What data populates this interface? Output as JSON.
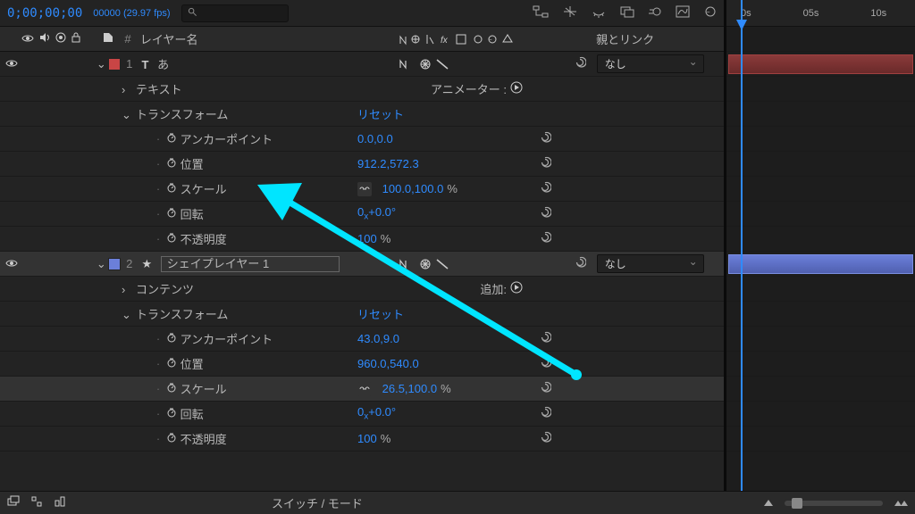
{
  "topbar": {
    "timecode": "0;00;00;00",
    "fps": "00000 (29.97 fps)"
  },
  "ruler": {
    "t0": "0s",
    "t1": "05s",
    "t2": "10s"
  },
  "header": {
    "name": "レイヤー名",
    "parent": "親とリンク",
    "hash": "#"
  },
  "layer1": {
    "num": "1",
    "type_glyph": "T",
    "name": "あ",
    "parent": "なし",
    "text_group": "テキスト",
    "animator": "アニメーター :",
    "transform": "トランスフォーム",
    "reset": "リセット",
    "anchor_label": "アンカーポイント",
    "anchor_val": "0.0,0.0",
    "pos_label": "位置",
    "pos_val": "912.2,572.3",
    "scale_label": "スケール",
    "scale_val": "100.0,100.0",
    "scale_unit": "%",
    "rot_label": "回転",
    "rot_x": "0",
    "rot_deg": "+0.0°",
    "op_label": "不透明度",
    "op_val": "100",
    "op_unit": "%"
  },
  "layer2": {
    "num": "2",
    "name": "シェイプレイヤー 1",
    "parent": "なし",
    "contents": "コンテンツ",
    "add": "追加:",
    "transform": "トランスフォーム",
    "reset": "リセット",
    "anchor_label": "アンカーポイント",
    "anchor_val": "43.0,9.0",
    "pos_label": "位置",
    "pos_val": "960.0,540.0",
    "scale_label": "スケール",
    "scale_val": "26.5,100.0",
    "scale_unit": "%",
    "rot_label": "回転",
    "rot_x": "0",
    "rot_deg": "+0.0°",
    "op_label": "不透明度",
    "op_val": "100",
    "op_unit": "%"
  },
  "bottom": {
    "switch_mode": "スイッチ / モード"
  }
}
